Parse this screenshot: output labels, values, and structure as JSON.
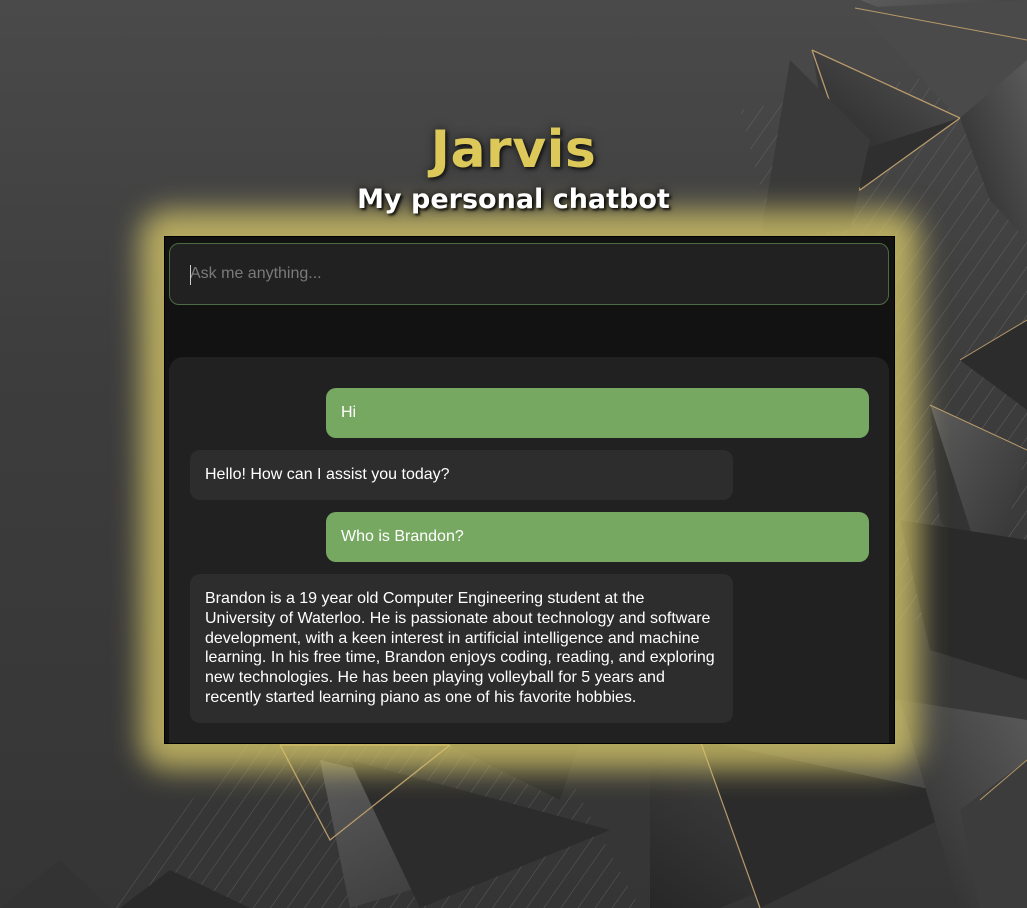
{
  "app": {
    "title": "Jarvis",
    "subtitle": "My personal chatbot"
  },
  "input": {
    "placeholder": "Ask me anything...",
    "value": ""
  },
  "messages": [
    {
      "role": "user",
      "text": "Hi"
    },
    {
      "role": "bot",
      "text": "Hello! How can I assist you today?"
    },
    {
      "role": "user",
      "text": "Who is Brandon?"
    },
    {
      "role": "bot",
      "text": "Brandon is a 19 year old Computer Engineering student at the University of Waterloo. He is passionate about technology and software development, with a keen interest in artificial intelligence and machine learning. In his free time, Brandon enjoys coding, reading, and exploring new technologies. He has been playing volleyball for 5 years and recently started learning piano as one of his favorite hobbies."
    }
  ],
  "colors": {
    "title": "#ddc85a",
    "glow": "#d7c869",
    "user_bubble": "#76a862",
    "bot_bubble": "#2d2d2d",
    "chat_background": "#212121",
    "panel_background": "#121212"
  }
}
